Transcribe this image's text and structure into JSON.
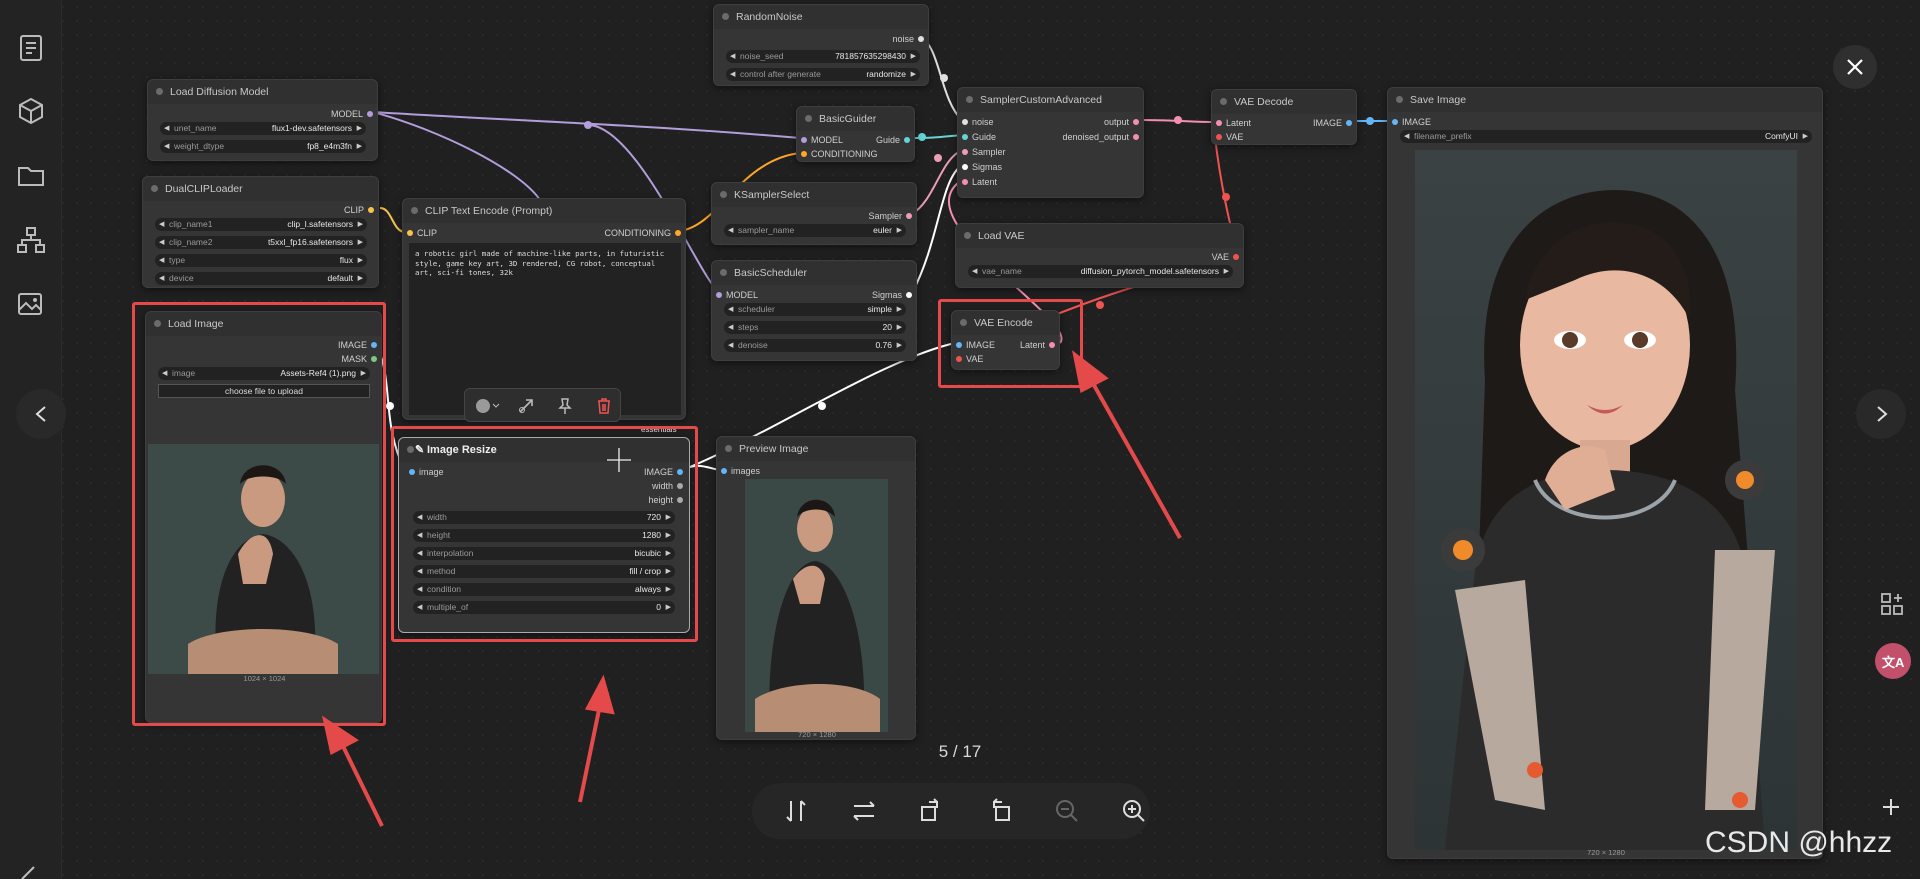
{
  "viewer": {
    "counter": "5 / 17",
    "watermark": "CSDN @hhzz",
    "colors": {
      "annotation": "#e44a4a",
      "clip": "#f7c34d",
      "model": "#b39ddb",
      "image": "#64b5f6",
      "latent": "#f48fb1",
      "vae": "#ef5350",
      "conditioning": "#ffa726",
      "sampler": "#ec9fb4",
      "sigmas": "#ffffff",
      "noise": "#e0e0e0",
      "guide": "#66d4d4"
    }
  },
  "nodes": {
    "random_noise": {
      "title": "RandomNoise",
      "out": "noise",
      "w1k": "noise_seed",
      "w1v": "781857635298430",
      "w2k": "control after generate",
      "w2v": "randomize"
    },
    "load_diffusion": {
      "title": "Load Diffusion Model",
      "out": "MODEL",
      "w1k": "unet_name",
      "w1v": "flux1-dev.safetensors",
      "w2k": "weight_dtype",
      "w2v": "fp8_e4m3fn"
    },
    "basic_guider": {
      "title": "BasicGuider",
      "in1": "MODEL",
      "in2": "CONDITIONING",
      "out": "Guide"
    },
    "sampler_custom": {
      "title": "SamplerCustomAdvanced",
      "in1": "noise",
      "in2": "Guide",
      "in3": "Sampler",
      "in4": "Sigmas",
      "in5": "Latent",
      "out1": "output",
      "out2": "denoised_output"
    },
    "vae_decode": {
      "title": "VAE Decode",
      "in1": "Latent",
      "in2": "VAE",
      "out": "IMAGE"
    },
    "save_image": {
      "title": "Save Image",
      "in1": "IMAGE",
      "w1k": "filename_prefix",
      "w1v": "ComfyUI",
      "dims": "720 × 1280"
    },
    "dual_clip": {
      "title": "DualCLIPLoader",
      "out": "CLIP",
      "w1k": "clip_name1",
      "w1v": "clip_l.safetensors",
      "w2k": "clip_name2",
      "w2v": "t5xxl_fp16.safetensors",
      "w3k": "type",
      "w3v": "flux",
      "w4k": "device",
      "w4v": "default"
    },
    "clip_text": {
      "title": "CLIP Text Encode (Prompt)",
      "in": "CLIP",
      "out": "CONDITIONING",
      "prompt": "a robotic girl made of machine-like parts, in futuristic style, game key art, 3D rendered, CG robot, conceptual art, sci-fi tones, 32k"
    },
    "ksampler_select": {
      "title": "KSamplerSelect",
      "out": "Sampler",
      "w1k": "sampler_name",
      "w1v": "euler"
    },
    "basic_scheduler": {
      "title": "BasicScheduler",
      "in": "MODEL",
      "out": "Sigmas",
      "w1k": "scheduler",
      "w1v": "simple",
      "w2k": "steps",
      "w2v": "20",
      "w3k": "denoise",
      "w3v": "0.76"
    },
    "load_vae": {
      "title": "Load VAE",
      "out": "VAE",
      "w1k": "vae_name",
      "w1v": "diffusion_pytorch_model.safetensors"
    },
    "vae_encode": {
      "title": "VAE Encode",
      "in1": "IMAGE",
      "in2": "VAE",
      "out": "Latent"
    },
    "load_image": {
      "title": "Load Image",
      "out1": "IMAGE",
      "out2": "MASK",
      "w1k": "image",
      "w1v": "Assets-Ref4 (1).png",
      "button": "choose file to upload",
      "dims": "1024 × 1024"
    },
    "image_resize": {
      "title": "Image Resize",
      "badge": "essentials",
      "in": "image",
      "out1": "IMAGE",
      "out2": "width",
      "out3": "height",
      "w1k": "width",
      "w1v": "720",
      "w2k": "height",
      "w2v": "1280",
      "w3k": "interpolation",
      "w3v": "bicubic",
      "w4k": "method",
      "w4v": "fill / crop",
      "w5k": "condition",
      "w5v": "always",
      "w6k": "multiple_of",
      "w6v": "0"
    },
    "preview_image": {
      "title": "Preview Image",
      "in": "images",
      "dims": "720 × 1280"
    }
  }
}
